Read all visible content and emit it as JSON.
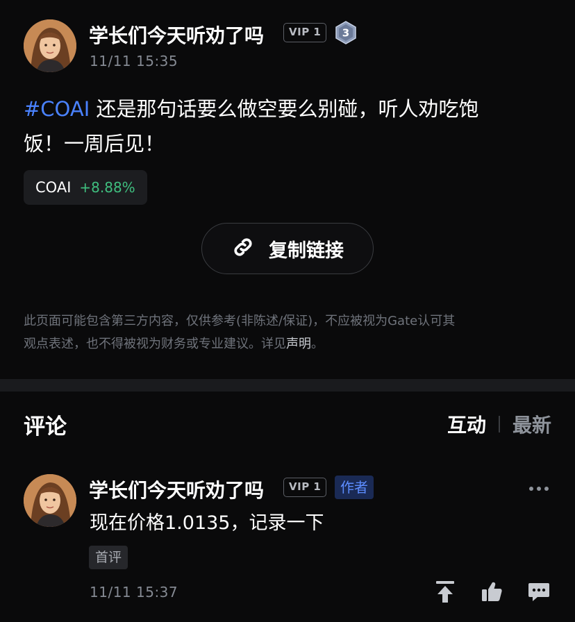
{
  "post": {
    "author": {
      "name": "学长们今天听劝了吗",
      "vip_label": "VIP 1",
      "level": "3"
    },
    "timestamp": "11/11 15:35",
    "hashtag": "#COAI",
    "text_line1": " 还是那句话要么做空要么别碰，听人劝吃饱",
    "text_line2": "饭！一周后见！",
    "ticker": {
      "symbol": "COAI",
      "change": "+8.88%"
    },
    "copy_link_label": "复制链接",
    "disclaimer_line1": "此页面可能包含第三方内容，仅供参考(非陈述/保证)，不应被视为Gate认可其",
    "disclaimer_line2": "观点表述，也不得被视为财务或专业建议。详见",
    "disclaimer_link": "声明",
    "disclaimer_end": "。"
  },
  "comments_section": {
    "title": "评论",
    "sort_active": "互动",
    "sort_inactive": "最新"
  },
  "comments": [
    {
      "author_name": "学长们今天听劝了吗",
      "vip_label": "VIP 1",
      "author_tag": "作者",
      "text": "现在价格1.0135，记录一下",
      "badge": "首评",
      "timestamp": "11/11 15:37"
    }
  ],
  "icons": {
    "more": "more-dots-icon",
    "pin": "pin-to-top-icon",
    "like": "thumbs-up-icon",
    "reply": "comment-bubble-icon",
    "link": "link-chain-icon"
  },
  "colors": {
    "background": "#0a0a0b",
    "hashtag": "#4a82ff",
    "positive": "#3fbf7f",
    "author_tag_bg": "#1a2a55"
  }
}
